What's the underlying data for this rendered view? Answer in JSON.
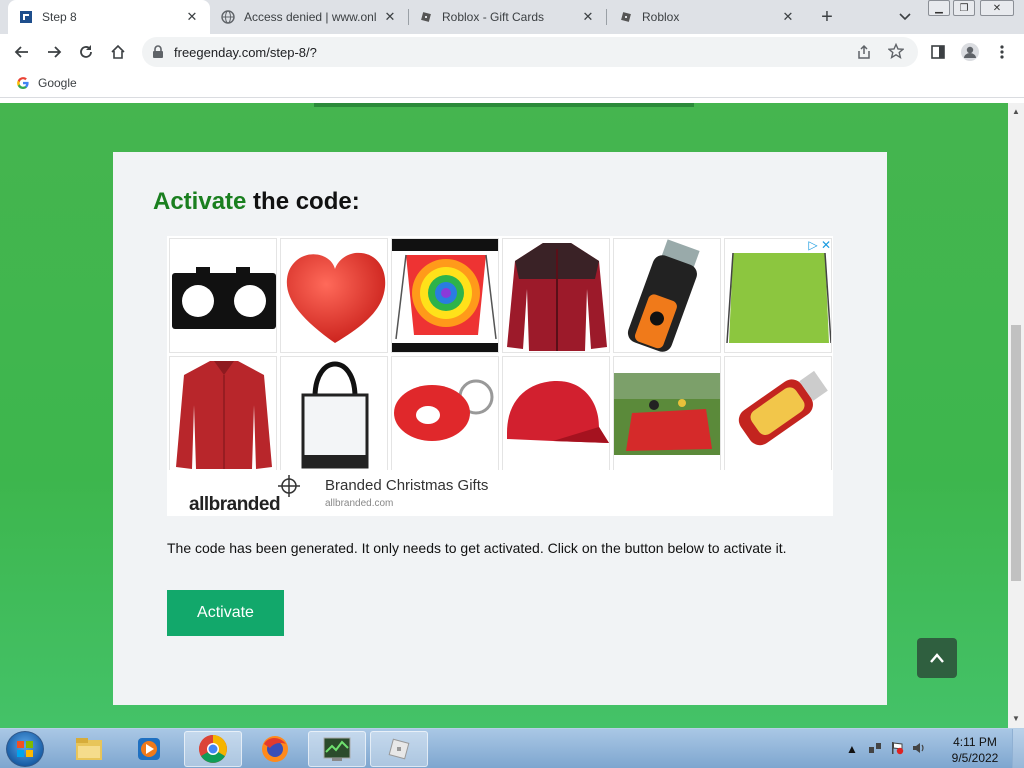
{
  "browser": {
    "tabs": [
      {
        "title": "Step 8",
        "icon": "freegenday-favicon",
        "active": true
      },
      {
        "title": "Access denied | www.onl",
        "icon": "globe-icon",
        "active": false
      },
      {
        "title": "Roblox - Gift Cards",
        "icon": "roblox-icon",
        "active": false
      },
      {
        "title": "Roblox",
        "icon": "roblox-icon",
        "active": false
      }
    ],
    "url": "freegenday.com/step-8/?",
    "bookmarks": [
      {
        "label": "Google",
        "icon": "google-icon"
      }
    ]
  },
  "page": {
    "heading_accent": "Activate",
    "heading_rest": " the code:",
    "ad": {
      "brand": "allbranded",
      "title": "Branded Christmas Gifts",
      "domain": "allbranded.com",
      "choices_label": "▷ ✕"
    },
    "body_text": "The code has been generated. It only needs to get activated. Click on the button below to activate it.",
    "activate_label": "Activate"
  },
  "taskbar": {
    "time": "4:11 PM",
    "date": "9/5/2022",
    "apps": [
      "file-explorer",
      "media-player",
      "chrome",
      "firefox",
      "task-manager",
      "roblox"
    ]
  },
  "colors": {
    "page_green": "#45b54f",
    "accent_green": "#1a7f1f",
    "button_green": "#12a86b"
  }
}
